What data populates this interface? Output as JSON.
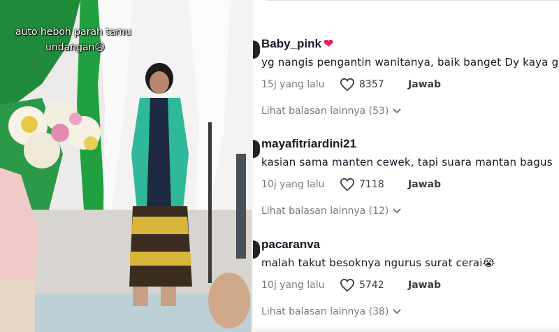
{
  "video": {
    "caption_line1": "auto heboh parah tamu",
    "caption_line2": "undangan😥"
  },
  "comments": [
    {
      "username": "Baby_pink",
      "badge_emoji": "❤",
      "text": "yg nangis pengantin wanitanya, baik banget Dy kaya g",
      "time": "15j yang lalu",
      "likes": "8357",
      "reply_label": "Jawab",
      "more_replies": "Lihat balasan lainnya (53)"
    },
    {
      "username": "mayafitriardini21",
      "text": "kasian sama manten cewek, tapi suara mantan bagus",
      "time": "10j yang lalu",
      "likes": "7118",
      "reply_label": "Jawab",
      "more_replies": "Lihat balasan lainnya (12)"
    },
    {
      "username": "pacaranva",
      "text": "malah takut besoknya ngurus surat cerai😭",
      "time": "10j yang lalu",
      "likes": "5742",
      "reply_label": "Jawab",
      "more_replies": "Lihat balasan lainnya (38)"
    }
  ],
  "icons": {
    "like": "heart-outline-icon",
    "expand": "chevron-down-icon"
  },
  "colors": {
    "primary_text": "#161823",
    "secondary_text": "#7a7b82",
    "heart_emoji": "#e0245e"
  }
}
